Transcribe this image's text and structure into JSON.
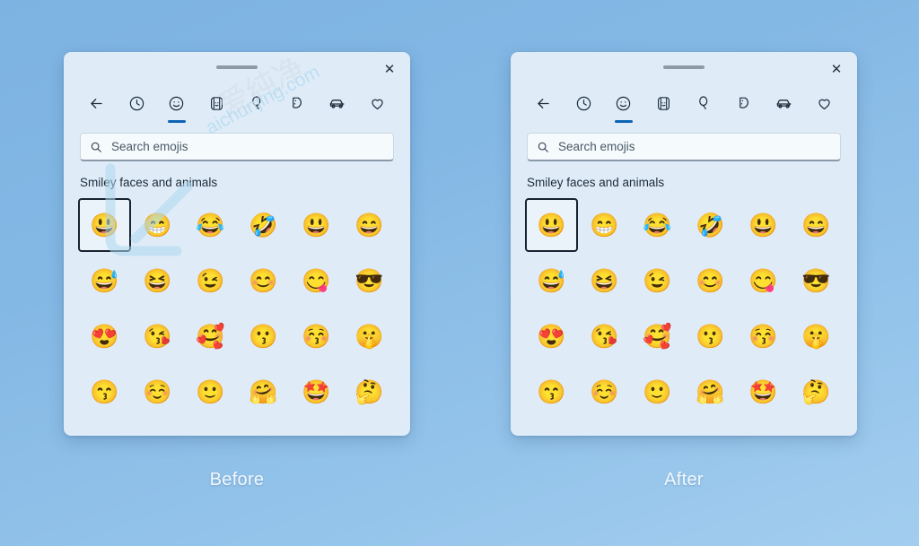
{
  "page": {
    "background_top_color": "#7db3e2",
    "background_bottom_color": "#a2cdef"
  },
  "panels": [
    {
      "id": "before",
      "caption": "Before",
      "close_label": "✕",
      "has_watermark": true
    },
    {
      "id": "after",
      "caption": "After",
      "close_label": "✕",
      "has_watermark": false
    }
  ],
  "panel": {
    "accent_color": "#0c63b5",
    "surface_color": "#dfecf8",
    "selection_border_color": "#172330",
    "tabs": [
      {
        "name": "back-icon",
        "label": "Back",
        "active": false
      },
      {
        "name": "clock-icon",
        "label": "Recent",
        "active": false
      },
      {
        "name": "smiley-icon",
        "label": "Emoji",
        "active": true
      },
      {
        "name": "person-icon",
        "label": "People",
        "active": false
      },
      {
        "name": "balloon-icon",
        "label": "Celebration",
        "active": false
      },
      {
        "name": "pizza-icon",
        "label": "Food",
        "active": false
      },
      {
        "name": "car-icon",
        "label": "Travel",
        "active": false
      },
      {
        "name": "heart-icon",
        "label": "Symbols",
        "active": false
      }
    ],
    "search": {
      "icon": "search-icon",
      "placeholder": "Search emojis",
      "value": ""
    },
    "section_title": "Smiley faces and animals",
    "emoji_rows": [
      [
        {
          "glyph": "😃",
          "name": "grinning-face-big-eyes",
          "selected": true
        },
        {
          "glyph": "😁",
          "name": "beaming-face",
          "selected": false
        },
        {
          "glyph": "😂",
          "name": "face-with-tears-of-joy",
          "selected": false
        },
        {
          "glyph": "🤣",
          "name": "rolling-on-the-floor-laughing",
          "selected": false
        },
        {
          "glyph": "😃",
          "name": "smiling-face-open-mouth",
          "selected": false
        },
        {
          "glyph": "😄",
          "name": "grinning-face-smiling-eyes",
          "selected": false
        }
      ],
      [
        {
          "glyph": "😅",
          "name": "grinning-face-sweat",
          "selected": false
        },
        {
          "glyph": "😆",
          "name": "squinting-face-tongue",
          "selected": false
        },
        {
          "glyph": "😉",
          "name": "winking-face",
          "selected": false
        },
        {
          "glyph": "😊",
          "name": "smiling-face-smiling-eyes",
          "selected": false
        },
        {
          "glyph": "😋",
          "name": "face-savoring-food",
          "selected": false
        },
        {
          "glyph": "😎",
          "name": "smiling-face-with-sunglasses",
          "selected": false
        }
      ],
      [
        {
          "glyph": "😍",
          "name": "smiling-face-heart-eyes",
          "selected": false
        },
        {
          "glyph": "😘",
          "name": "face-blowing-a-kiss",
          "selected": false
        },
        {
          "glyph": "🥰",
          "name": "smiling-face-with-hearts",
          "selected": false
        },
        {
          "glyph": "😗",
          "name": "kissing-face",
          "selected": false
        },
        {
          "glyph": "😚",
          "name": "kissing-face-closed-eyes",
          "selected": false
        },
        {
          "glyph": "🤫",
          "name": "shushing-face",
          "selected": false
        }
      ],
      [
        {
          "glyph": "😙",
          "name": "kissing-face-smiling-eyes",
          "selected": false
        },
        {
          "glyph": "☺️",
          "name": "smiling-face",
          "selected": false
        },
        {
          "glyph": "🙂",
          "name": "slightly-smiling-face",
          "selected": false
        },
        {
          "glyph": "🤗",
          "name": "hugging-face",
          "selected": false
        },
        {
          "glyph": "🤩",
          "name": "star-struck",
          "selected": false
        },
        {
          "glyph": "🤔",
          "name": "thinking-face",
          "selected": false
        }
      ]
    ]
  },
  "watermark": {
    "text_en": "aichunjing.com",
    "text_cn": "爱纯净"
  }
}
